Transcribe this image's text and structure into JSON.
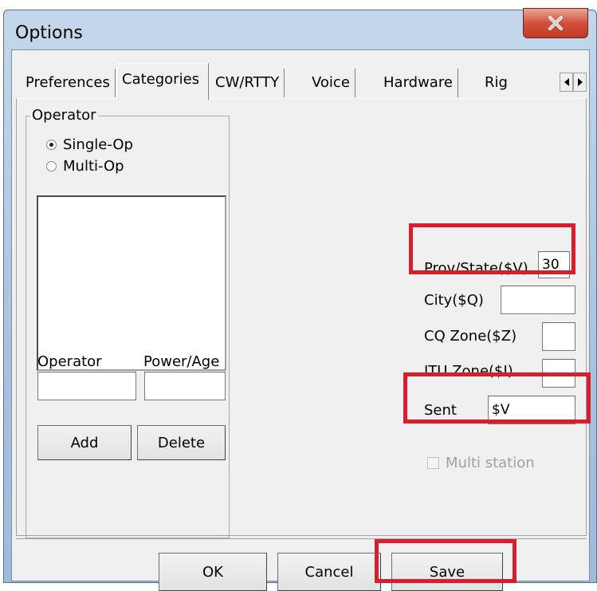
{
  "window": {
    "title": "Options"
  },
  "tabs": [
    {
      "label": "Preferences",
      "active": false
    },
    {
      "label": "Categories",
      "active": true
    },
    {
      "label": "CW/RTTY",
      "active": false
    },
    {
      "label": "Voice",
      "active": false
    },
    {
      "label": "Hardware",
      "active": false
    },
    {
      "label": "Rig",
      "active": false
    }
  ],
  "operator_group": {
    "legend": "Operator",
    "single_op": "Single-Op",
    "multi_op": "Multi-Op",
    "selected": "Single-Op",
    "operator_label": "Operator",
    "power_age_label": "Power/Age",
    "operator_value": "",
    "power_age_value": "",
    "add_label": "Add",
    "delete_label": "Delete"
  },
  "fields": {
    "prov_state_label": "Prov/State($V)",
    "prov_state_value": "30",
    "city_label": "City($Q)",
    "city_value": "",
    "cq_zone_label": "CQ Zone($Z)",
    "cq_zone_value": "",
    "itu_zone_label": "ITU Zone($I)",
    "itu_zone_value": "",
    "sent_label": "Sent",
    "sent_value": "$V",
    "multi_station_label": "Multi station",
    "multi_station_checked": false
  },
  "buttons": {
    "ok": "OK",
    "cancel": "Cancel",
    "save": "Save"
  },
  "icons": {
    "close": "close-icon",
    "scroll_left": "arrow-left-icon",
    "scroll_right": "arrow-right-icon"
  },
  "colors": {
    "highlight": "#d81d2c",
    "title_bar": "#a9c3df",
    "dialog_bg": "#f0f0f0",
    "close_button": "#c33a26"
  }
}
